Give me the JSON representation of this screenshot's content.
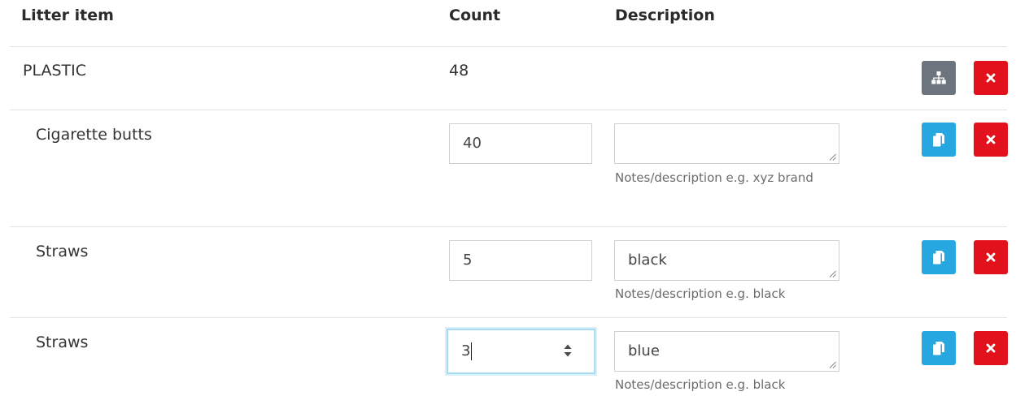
{
  "header": {
    "item": "Litter item",
    "count": "Count",
    "description": "Description"
  },
  "category": {
    "name": "PLASTIC",
    "count": "48"
  },
  "rows": [
    {
      "name": "Cigarette butts",
      "count": "40",
      "description": "",
      "help": "Notes/description e.g. xyz brand"
    },
    {
      "name": "Straws",
      "count": "5",
      "description": "black",
      "help": "Notes/description e.g. black"
    },
    {
      "name": "Straws",
      "count": "3",
      "description": "blue",
      "help": "Notes/description e.g. black"
    }
  ],
  "icons": {
    "category_button": "sitemap-icon",
    "row_button": "copy-icon",
    "delete_button": "close-icon"
  },
  "colors": {
    "grey_button": "#6c757d",
    "blue_button": "#27a7e0",
    "red_button": "#e1121b",
    "focus_ring": "#a8dcf3"
  }
}
